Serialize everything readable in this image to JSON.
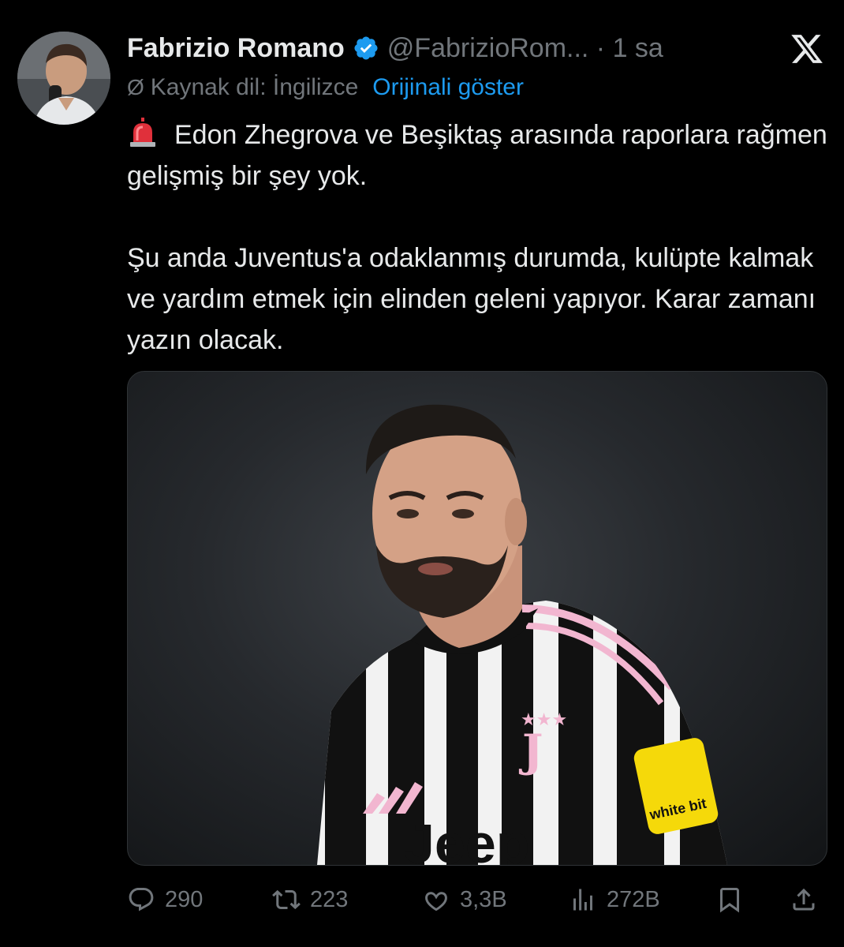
{
  "tweet": {
    "author_name": "Fabrizio Romano",
    "handle_time": "@FabrizioRom... · 1 sa",
    "translation_note": "Kaynak dil: İngilizce",
    "show_original": "Orijinali göster",
    "paragraph_1": "Edon Zhegrova ve Beşiktaş arasında raporlara rağmen gelişmiş bir şey yok.",
    "paragraph_2": "Şu anda Juventus'a odaklanmış durumda, kulüpte kalmak ve yardım etmek için elinden geleni yapıyor. Karar zamanı yazın olacak."
  },
  "media": {
    "shirt_sponsor": "Jeep",
    "sleeve_sponsor": "white bit"
  },
  "actions": {
    "replies": "290",
    "reposts": "223",
    "likes": "3,3B",
    "views": "272B"
  },
  "colors": {
    "background": "#000000",
    "text": "#e7e9ea",
    "muted": "#71767b",
    "link": "#1d9bf0",
    "verified": "#1d9bf0"
  },
  "icons": [
    "x-logo-icon",
    "verified-badge-icon",
    "globe-icon",
    "siren-icon",
    "reply-icon",
    "repost-icon",
    "like-icon",
    "views-icon",
    "bookmark-icon",
    "share-icon"
  ]
}
